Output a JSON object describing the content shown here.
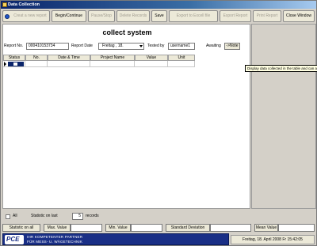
{
  "window": {
    "title": "Data Collection"
  },
  "toolbar": {
    "buttons": [
      {
        "label": "Creat a new report",
        "enabled": false
      },
      {
        "label": "Begin/Continue",
        "enabled": true
      },
      {
        "label": "Pause/Stop",
        "enabled": false
      },
      {
        "label": "Delete Records",
        "enabled": false
      },
      {
        "label": "Save",
        "enabled": true
      },
      {
        "label": "Export to Excell file",
        "enabled": false
      },
      {
        "label": "Export Report",
        "enabled": false
      },
      {
        "label": "Print Report",
        "enabled": false
      },
      {
        "label": "Close Window",
        "enabled": true
      }
    ]
  },
  "form": {
    "title": "collect system",
    "report_no_label": "Report No.",
    "report_no_value": "000410153734",
    "report_date_label": "Report Date",
    "report_date_value": "Freitag  , 18.",
    "tested_by_label": "Tested by",
    "tested_by_value": "username1",
    "awaiting_label": "Awaiting",
    "note_button": "->Note"
  },
  "table": {
    "columns": [
      "Status",
      "No.",
      "Date & Time",
      "Project Name",
      "Value",
      "Unit"
    ]
  },
  "tooltip": "Display data collected in the table and can a",
  "stats": {
    "all_label": "All",
    "statistic_on_last_label": "Statistic on last",
    "last_count": "5",
    "records_label": "records",
    "statistic_on_all_button": "Statistic on all",
    "max_value_label": "Max. Value",
    "min_value_label": "Min. Value",
    "std_dev_label": "Standard Deviation",
    "mean_value_label": "Mean Value"
  },
  "footer": {
    "logo_text": "PCE",
    "slogan_line1": "IHR KOMPETENTER PARTNER",
    "slogan_line2": "FÜR MESS- U. WÄGETECHNIK",
    "status_text": "Freitag, 18. April 2008 Fr 15:42:05"
  },
  "colors": {
    "titlebar": "#0a246a",
    "face": "#d4d0c8",
    "logo_blue": "#1a2f86"
  }
}
